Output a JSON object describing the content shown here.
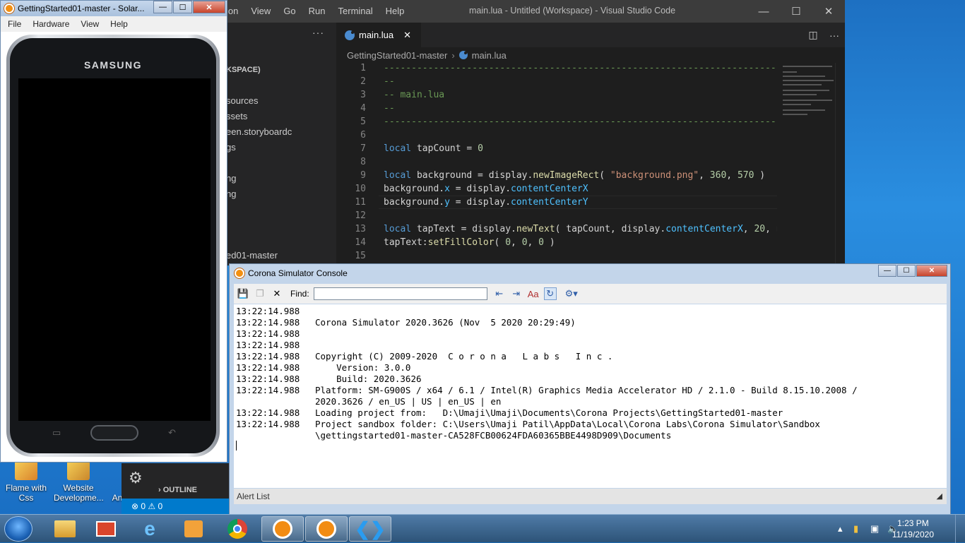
{
  "vscode": {
    "menu": [
      "ion",
      "View",
      "Go",
      "Run",
      "Terminal",
      "Help"
    ],
    "title": "main.lua - Untitled (Workspace) - Visual Studio Code",
    "sidebar_partial": [
      "KSPACE)",
      "sources",
      "ssets",
      "een.storyboardc",
      "gs",
      "ng",
      "ng",
      "ed01-master"
    ],
    "tab_label": "main.lua",
    "breadcrumb": [
      "GettingStarted01-master",
      "main.lua"
    ],
    "outline_label": "OUTLINE",
    "status_problems": "⊗ 0 ⚠ 0",
    "line_numbers": [
      "1",
      "2",
      "3",
      "4",
      "5",
      "6",
      "7",
      "8",
      "9",
      "10",
      "11",
      "12",
      "13",
      "14",
      "15"
    ],
    "code": {
      "l1": "-----------------------------------------------------------------------------------",
      "l2": "--",
      "l3": "-- main.lua",
      "l4": "--",
      "l5": "-----------------------------------------------------------------------------------",
      "l7_kw": "local",
      "l7_rest": " tapCount = ",
      "l7_num": "0",
      "l9_kw": "local",
      "l9_a": " background = display.",
      "l9_fn": "newImageRect",
      "l9_b": "( ",
      "l9_str": "\"background.png\"",
      "l9_c": ", ",
      "l9_n1": "360",
      "l9_d": ", ",
      "l9_n2": "570",
      "l9_e": " )",
      "l10_a": "background.",
      "l10_p": "x",
      "l10_b": " = display.",
      "l10_q": "contentCenterX",
      "l11_a": "background.",
      "l11_p": "y",
      "l11_b": " = display.",
      "l11_q": "contentCenterY",
      "l13_kw": "local",
      "l13_a": " tapText = display.",
      "l13_fn": "newText",
      "l13_b": "( tapCount, display.",
      "l13_q": "contentCenterX",
      "l13_c": ", ",
      "l13_n": "20",
      "l13_d": ", na",
      "l14_a": "tapText:",
      "l14_fn": "setFillColor",
      "l14_b": "( ",
      "l14_n1": "0",
      "l14_c": ", ",
      "l14_n2": "0",
      "l14_d": ", ",
      "l14_n3": "0",
      "l14_e": " )"
    }
  },
  "simulator": {
    "title": "GettingStarted01-master - Solar...",
    "menu": [
      "File",
      "Hardware",
      "View",
      "Help"
    ],
    "brand": "SAMSUNG"
  },
  "desktop_icons": [
    "Flame with Css",
    "Website Developme...",
    "Ana"
  ],
  "console": {
    "title": "Corona Simulator Console",
    "find_label": "Find:",
    "find_value": "",
    "alert_label": "Alert List",
    "lines": [
      {
        "t": "13:22:14.988",
        "m": ""
      },
      {
        "t": "13:22:14.988",
        "m": "Corona Simulator 2020.3626 (Nov  5 2020 20:29:49)"
      },
      {
        "t": "13:22:14.988",
        "m": ""
      },
      {
        "t": "13:22:14.988",
        "m": ""
      },
      {
        "t": "13:22:14.988",
        "m": "Copyright (C) 2009-2020  C o r o n a   L a b s   I n c ."
      },
      {
        "t": "13:22:14.988",
        "m": "    Version: 3.0.0"
      },
      {
        "t": "13:22:14.988",
        "m": "    Build: 2020.3626"
      },
      {
        "t": "13:22:14.988",
        "m": "Platform: SM-G900S / x64 / 6.1 / Intel(R) Graphics Media Accelerator HD / 2.1.0 - Build 8.15.10.2008 /"
      },
      {
        "t": "",
        "m": "2020.3626 / en_US | US | en_US | en"
      },
      {
        "t": "13:22:14.988",
        "m": "Loading project from:   D:\\Umaji\\Umaji\\Documents\\Corona Projects\\GettingStarted01-master"
      },
      {
        "t": "13:22:14.988",
        "m": "Project sandbox folder: C:\\Users\\Umaji Patil\\AppData\\Local\\Corona Labs\\Corona Simulator\\Sandbox"
      },
      {
        "t": "",
        "m": "\\gettingstarted01-master-CA528FCB00624FDA60365BBE4498D909\\Documents"
      }
    ]
  },
  "taskbar": {
    "time": "1:23 PM",
    "date": "11/19/2020"
  }
}
